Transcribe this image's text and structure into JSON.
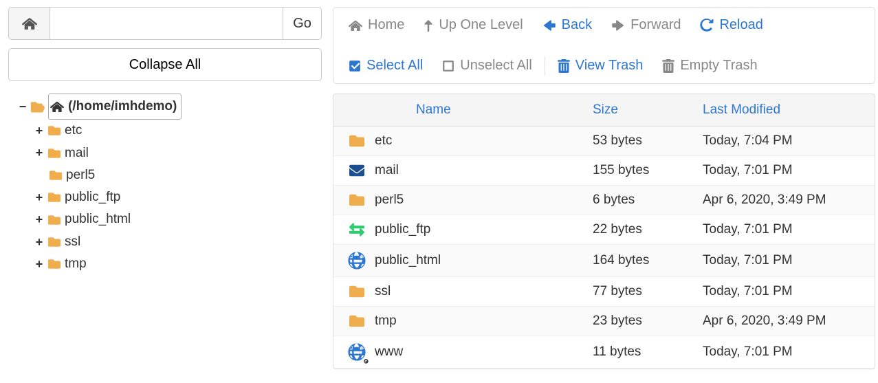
{
  "pathbar": {
    "go_label": "Go",
    "input_value": ""
  },
  "collapse_label": "Collapse All",
  "tree": {
    "root_label": "(/home/imhdemo)",
    "children": [
      {
        "label": "etc",
        "expandable": true
      },
      {
        "label": "mail",
        "expandable": true
      },
      {
        "label": "perl5",
        "expandable": false
      },
      {
        "label": "public_ftp",
        "expandable": true
      },
      {
        "label": "public_html",
        "expandable": true
      },
      {
        "label": "ssl",
        "expandable": true
      },
      {
        "label": "tmp",
        "expandable": true
      }
    ]
  },
  "toolbar": {
    "home": "Home",
    "up": "Up One Level",
    "back": "Back",
    "forward": "Forward",
    "reload": "Reload",
    "select_all": "Select All",
    "unselect_all": "Unselect All",
    "view_trash": "View Trash",
    "empty_trash": "Empty Trash"
  },
  "table": {
    "headers": {
      "name": "Name",
      "size": "Size",
      "modified": "Last Modified"
    },
    "rows": [
      {
        "icon": "folder",
        "name": "etc",
        "size": "53 bytes",
        "modified": "Today, 7:04 PM"
      },
      {
        "icon": "mail",
        "name": "mail",
        "size": "155 bytes",
        "modified": "Today, 7:01 PM"
      },
      {
        "icon": "folder",
        "name": "perl5",
        "size": "6 bytes",
        "modified": "Apr 6, 2020, 3:49 PM"
      },
      {
        "icon": "arrows",
        "name": "public_ftp",
        "size": "22 bytes",
        "modified": "Today, 7:01 PM"
      },
      {
        "icon": "globe",
        "name": "public_html",
        "size": "164 bytes",
        "modified": "Today, 7:01 PM"
      },
      {
        "icon": "folder",
        "name": "ssl",
        "size": "77 bytes",
        "modified": "Today, 7:01 PM"
      },
      {
        "icon": "folder",
        "name": "tmp",
        "size": "23 bytes",
        "modified": "Apr 6, 2020, 3:49 PM"
      },
      {
        "icon": "globe-link",
        "name": "www",
        "size": "11 bytes",
        "modified": "Today, 7:01 PM"
      }
    ]
  }
}
